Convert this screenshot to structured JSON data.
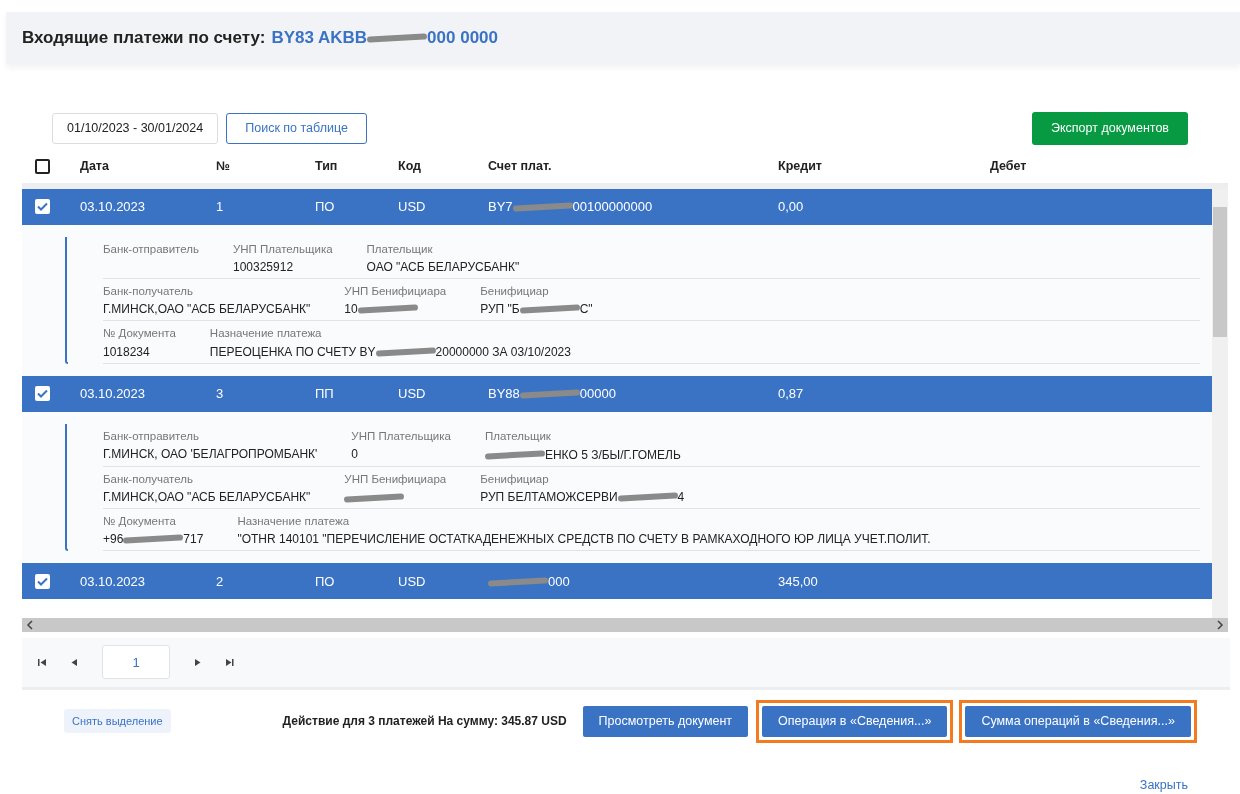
{
  "header": {
    "title": "Входящие платежи по счету:",
    "account": {
      "redacted": true,
      "before": "BY83 AKBB",
      "after": "000 0000"
    }
  },
  "toolbar": {
    "date_range": "01/10/2023 - 30/01/2024",
    "search_button": "Поиск по таблице",
    "export_button": "Экспорт документов"
  },
  "table": {
    "select_all": {
      "checked": false
    },
    "columns": [
      "Дата",
      "№",
      "Тип",
      "Код",
      "Счет плат.",
      "Кредит",
      "Дебет"
    ],
    "rows": [
      {
        "selected": true,
        "date": "03.10.2023",
        "number": "1",
        "type": "ПО",
        "currency": "USD",
        "account": {
          "redacted": true,
          "before": "BY7",
          "after": "00100000000"
        },
        "credit": "0,00",
        "details": [
          [
            {
              "label": "Банк-отправитель"
            },
            {
              "label": "УНП Плательщика",
              "value": "100325912"
            },
            {
              "label": "Плательщик",
              "value": "ОАО \"АСБ БЕЛАРУСБАНК\""
            }
          ],
          [
            {
              "label": "Банк-получатель",
              "value": "Г.МИНСК,ОАО \"АСБ БЕЛАРУСБАНК\""
            },
            {
              "label": "УНП Бенифициара",
              "value": {
                "redacted": true,
                "before": "10"
              }
            },
            {
              "label": "Бенифициар",
              "value": {
                "redacted": true,
                "before": "РУП \"Б",
                "after": "С\""
              }
            }
          ],
          [
            {
              "label": "№ Документа",
              "value": "1018234"
            },
            {
              "label": "Назначение платежа",
              "value": {
                "redacted": true,
                "before": "ПЕРЕОЦЕНКА ПО СЧЕТУ BY",
                "after": "20000000 ЗА 03/10/2023"
              }
            }
          ]
        ]
      },
      {
        "selected": true,
        "date": "03.10.2023",
        "number": "3",
        "type": "ПП",
        "currency": "USD",
        "account": {
          "redacted": true,
          "before": "BY88",
          "after": "00000"
        },
        "credit": "0,87",
        "details": [
          [
            {
              "label": "Банк-отправитель",
              "value": "Г.МИНСК, ОАО 'БЕЛАГРОПРОМБАНК'"
            },
            {
              "label": "УНП Плательщика",
              "value": "0"
            },
            {
              "label": "Плательщик",
              "value": {
                "redacted": true,
                "after": "ЕНКО 5 З/БЫ/Г.ГОМЕЛЬ"
              }
            }
          ],
          [
            {
              "label": "Банк-получатель",
              "value": "Г.МИНСК,ОАО \"АСБ БЕЛАРУСБАНК\""
            },
            {
              "label": "УНП Бенифициара",
              "value": {
                "redacted": true
              }
            },
            {
              "label": "Бенифициар",
              "value": {
                "redacted": true,
                "before": "РУП БЕЛТАМОЖСЕРВИ",
                "after": "4"
              }
            }
          ],
          [
            {
              "label": "№ Документа",
              "value": {
                "redacted": true,
                "before": "+96",
                "after": "717"
              }
            },
            {
              "label": "Назначение платежа",
              "value": "\"OTHR 140101 \"ПЕРЕЧИСЛЕНИЕ ОСТАТКАДЕНЕЖНЫХ СРЕДСТВ ПО СЧЕТУ В РАМКАХОДНОГО ЮР ЛИЦА УЧЕТ.ПОЛИТ."
            }
          ]
        ]
      },
      {
        "selected": true,
        "date": "03.10.2023",
        "number": "2",
        "type": "ПО",
        "currency": "USD",
        "account": {
          "redacted": true,
          "after": "000"
        },
        "credit": "345,00"
      }
    ]
  },
  "pagination": {
    "page": "1"
  },
  "footer": {
    "clear_button": "Снять выделение",
    "summary": "Действие для 3 платежей На сумму: 345.87 USD",
    "buttons": [
      {
        "label": "Просмотреть документ",
        "highlighted": false
      },
      {
        "label": "Операция в «Сведения...»",
        "highlighted": true
      },
      {
        "label": "Сумма операций в «Сведения...»",
        "highlighted": true
      }
    ],
    "close_link": "Закрыть"
  }
}
